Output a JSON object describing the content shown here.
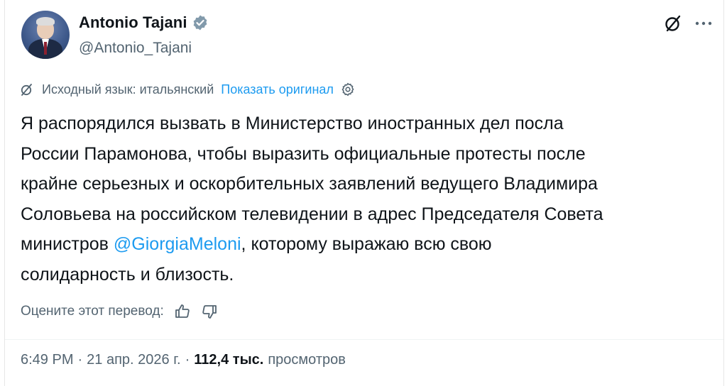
{
  "author": {
    "display_name": "Antonio Tajani",
    "handle": "@Antonio_Tajani"
  },
  "translation": {
    "source_label": "Исходный язык: итальянский",
    "show_original": "Показать оригинал"
  },
  "tweet": {
    "text_part1": "Я распорядился вызвать в Министерство иностранных дел посла\nРоссии Парамонова, чтобы выразить официальные протесты после\nкрайне серьезных и оскорбительных заявлений ведущего Владимира\nСоловьева на российском телевидении в адрес Председателя Совета\nминистров ",
    "mention": "@GiorgiaMeloni",
    "text_part2": ", которому выражаю всю свою\nсолидарность и близость."
  },
  "rating": {
    "label": "Оцените этот перевод:"
  },
  "meta": {
    "time": "6:49 PM",
    "separator1": "·",
    "date": "21 апр. 2026 г.",
    "separator2": "·",
    "views_count": "112,4 тыс.",
    "views_label": "просмотров"
  },
  "colors": {
    "accent": "#1d9bf0",
    "secondary_text": "#536471",
    "primary_text": "#0f1419"
  },
  "icons": {
    "verified": "verified-badge-icon",
    "grok": "grok-icon",
    "more": "more-icon",
    "translate": "translate-icon",
    "settings": "gear-icon",
    "thumbs_up": "thumbs-up-icon",
    "thumbs_down": "thumbs-down-icon"
  }
}
